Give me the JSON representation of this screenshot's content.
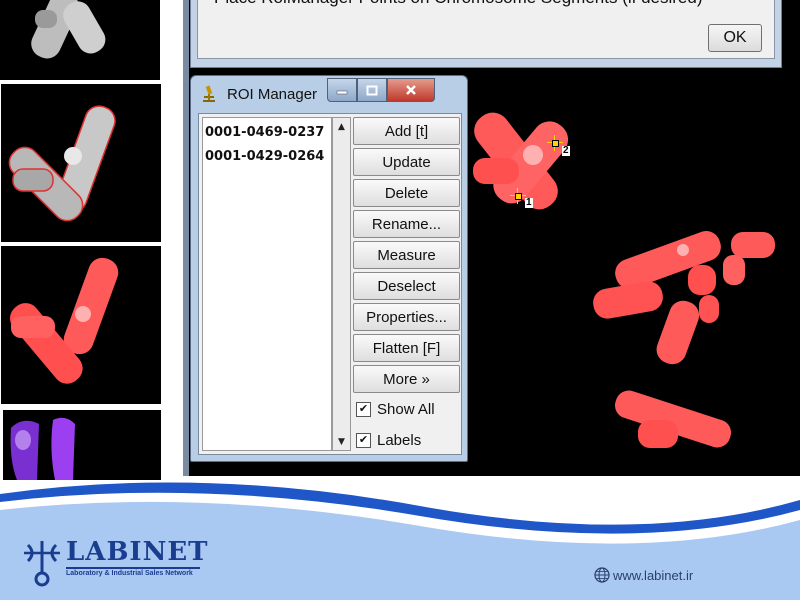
{
  "dialog": {
    "message": "Place RoiManager Points on Chromosome Segments (if desired)",
    "ok_label": "OK"
  },
  "roi_manager": {
    "title": "ROI Manager",
    "items": [
      "0001-0469-0237",
      "0001-0429-0264"
    ],
    "buttons": [
      {
        "label": "Add [t]"
      },
      {
        "label": "Update"
      },
      {
        "label": "Delete"
      },
      {
        "label": "Rename..."
      },
      {
        "label": "Measure"
      },
      {
        "label": "Deselect"
      },
      {
        "label": "Properties..."
      },
      {
        "label": "Flatten [F]"
      },
      {
        "label": "More »"
      }
    ],
    "checkboxes": [
      {
        "label": "Show All",
        "checked": true
      },
      {
        "label": "Labels",
        "checked": true
      }
    ],
    "window_icons": [
      "minimize-icon",
      "maximize-icon",
      "close-icon"
    ]
  },
  "image": {
    "point_labels": [
      "1",
      "2"
    ],
    "chromosome_color": "#ff5a5a"
  },
  "footer": {
    "logo_name": "LABINET",
    "logo_tagline": "Laboratory & Industrial Sales Network",
    "website": "www.labinet.ir",
    "accent_color": "#1a3d8f"
  }
}
